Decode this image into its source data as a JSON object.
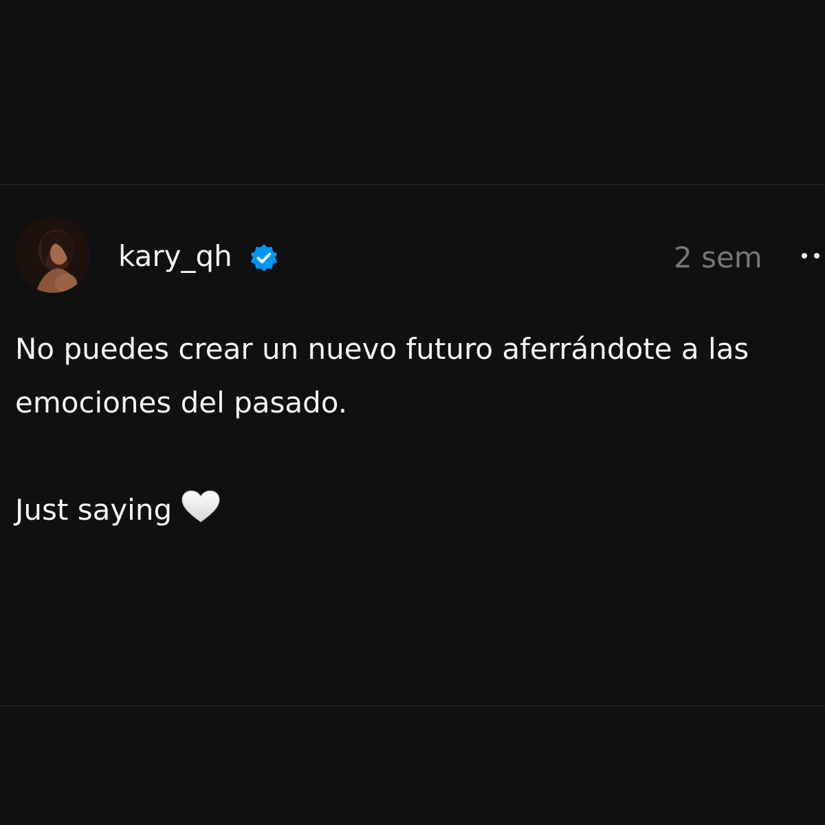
{
  "post": {
    "username": "kary_qh",
    "verified_icon": "verified-badge-icon",
    "timestamp": "2 sem",
    "more_icon": "more-options-icon",
    "text_line1": "No puedes crear un nuevo futuro aferrándote a las emociones del pasado.",
    "text_line2": "Just saying",
    "emoji_icon": "white-heart-icon"
  },
  "colors": {
    "background": "#101010",
    "divider": "#2c2c2c",
    "text": "#f3f5f7",
    "muted": "#777777",
    "verified_blue": "#0095f6"
  }
}
